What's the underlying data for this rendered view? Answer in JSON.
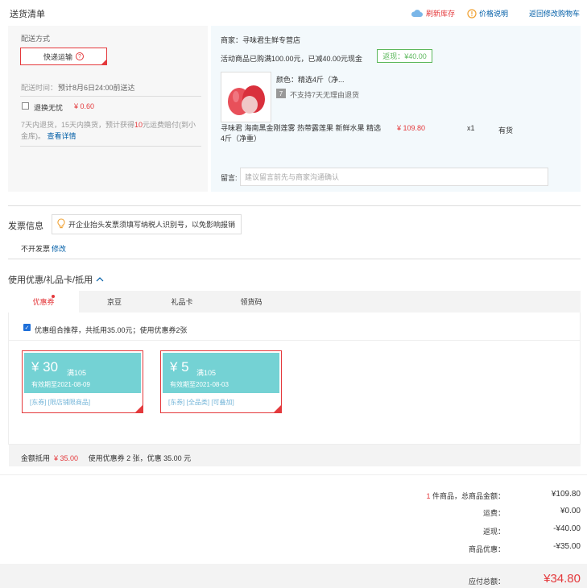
{
  "header": {
    "title": "送货清单",
    "refresh_label": "刷新库存",
    "price_label": "价格说明",
    "back_label": "返回修改购物车"
  },
  "delivery": {
    "method_label": "配送方式",
    "method_value": "快递运输",
    "time_label": "配送时间：",
    "time_value": "预计8月6日24:00前送达",
    "return_label": "退换无忧",
    "return_price": "¥ 0.60",
    "return_desc_1": "7天内退货，15天内换货，预计获得",
    "return_desc_amount": "10",
    "return_desc_2": "元运费赔付(到小金库)。",
    "return_details_link": "查看详情"
  },
  "order": {
    "merchant": "商家：寻味君生鲜专营店",
    "promo_text": "活动商品已购满100.00元，已减40.00元现金",
    "cashback": "返现：¥40.00",
    "color": "颜色：精选4斤（净...",
    "no_return_icon": "7",
    "no_return_text": "不支持7天无理由退货",
    "product_name": "寻味君 海南黑金刚莲雾 热带露莲果 新鲜水果 精选4斤（净重）",
    "price": "¥ 109.80",
    "qty": "x1",
    "stock": "有货",
    "remark_label": "留言:",
    "remark_placeholder": "建议留言前先与商家沟通确认"
  },
  "invoice": {
    "title": "发票信息",
    "tip": "开企业抬头发票须填写纳税人识别号，以免影响报销",
    "none": "不开发票",
    "edit": "修改"
  },
  "coupons": {
    "title": "使用优惠/礼品卡/抵用",
    "tabs": [
      {
        "label": "优惠券"
      },
      {
        "label": "京豆"
      },
      {
        "label": "礼品卡"
      },
      {
        "label": "领货码"
      }
    ],
    "combo_text": "优惠组合推荐，共抵用35.00元；使用优惠券2张",
    "items": [
      {
        "amount": "¥ 30",
        "cond": "满105",
        "expire": "有效期至2021-08-09",
        "tags": "[东券] [限店铺限商品]"
      },
      {
        "amount": "¥ 5",
        "cond": "满105",
        "expire": "有效期至2021-08-03",
        "tags": "[东券] [全品类] [可叠加]"
      }
    ],
    "summary_prefix": "金额抵用",
    "summary_amount": "¥ 35.00",
    "summary_suffix": "使用优惠券 2 张，优惠 35.00 元"
  },
  "totals": {
    "items_count": "1",
    "items_label": "件商品，总商品金额：",
    "items_value": "¥109.80",
    "freight_label": "运费：",
    "freight_value": "¥0.00",
    "row3_label": "返现：",
    "row3_value": "-¥40.00",
    "row4_label": "商品优惠：",
    "row4_value": "-¥35.00",
    "grand_label": "应付总额：",
    "grand_value": "¥34.80"
  },
  "colors": {
    "accent": "#e4393c",
    "link": "#005ea7",
    "coupon": "#74d2d4",
    "green": "#5cb85c"
  }
}
